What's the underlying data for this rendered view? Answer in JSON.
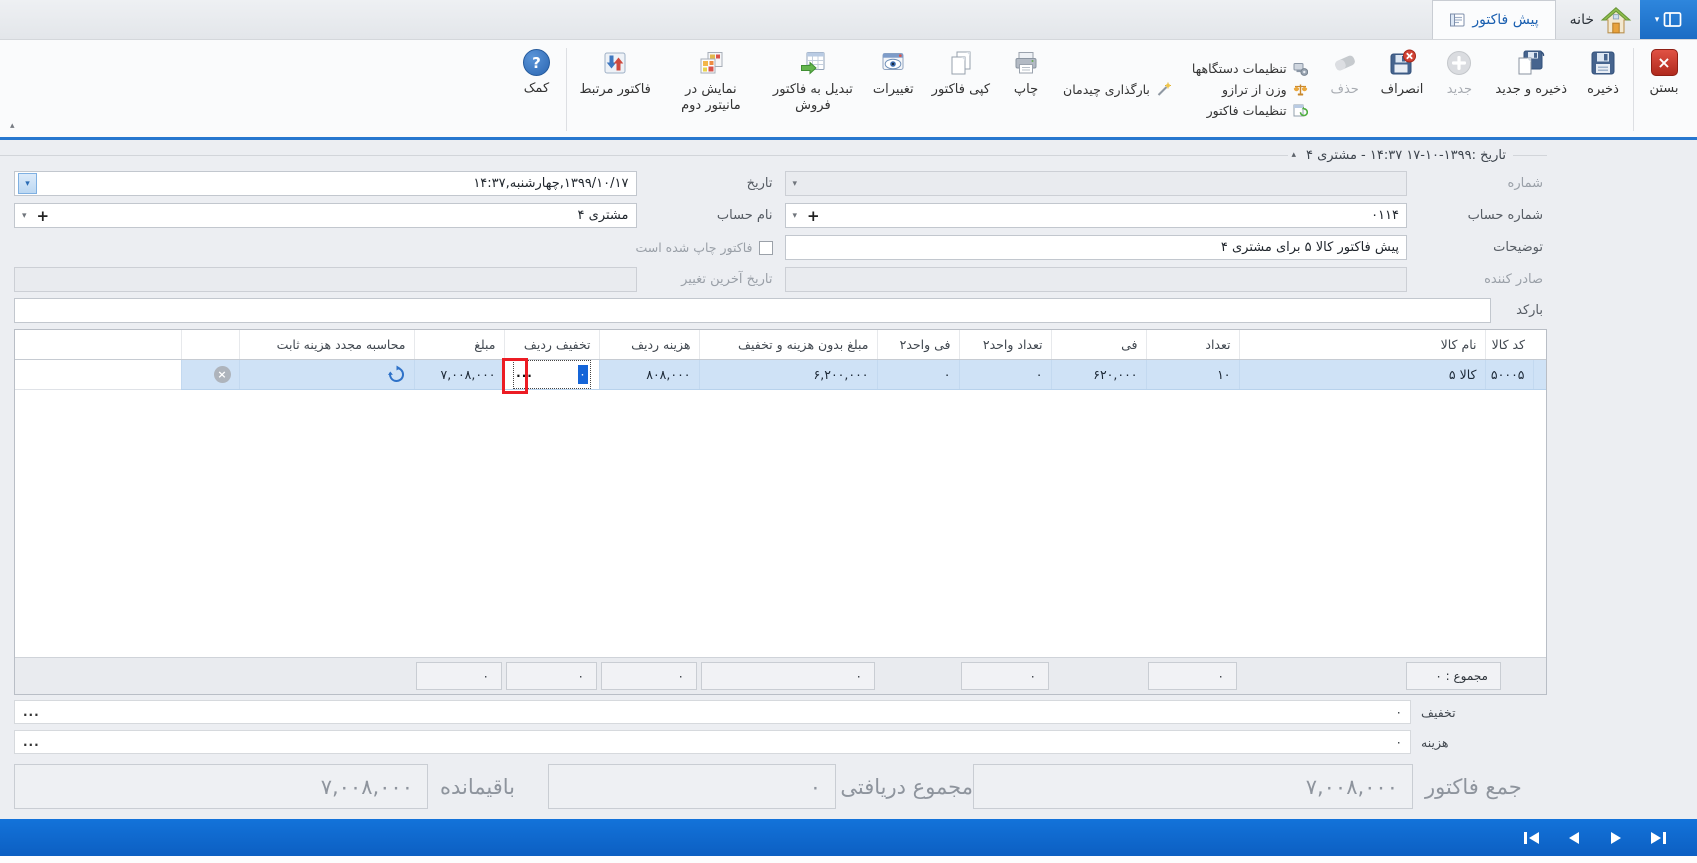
{
  "tabs": {
    "home_label": "خانه",
    "active_label": "پیش فاکتور"
  },
  "toolbar": {
    "close": "بستن",
    "save": "ذخیره",
    "save_and_new": "ذخیره و جدید",
    "new": "جدید",
    "cancel": "انصراف",
    "delete": "حذف",
    "device_settings": "تنظیمات دستگاهها",
    "weight_from_scale": "وزن از ترازو",
    "invoice_settings": "تنظیمات فاکتور",
    "load_layout": "بارگذاری چیدمان",
    "print": "چاپ",
    "copy_invoice": "کپی فاکتور",
    "changes": "تغییرات",
    "convert_to_sales_invoice": "تبدیل به فاکتور فروش",
    "show_on_second_monitor": "نمایش در مانیتور دوم",
    "related_invoice": "فاکتور مرتبط",
    "help": "کمک"
  },
  "group_header": {
    "title": "تاریخ :۱۳۹۹-۱۰-۱۷  ۱۴:۳۷ - مشتری ۴"
  },
  "form": {
    "number_label": "شماره",
    "number_value": "",
    "date_label": "تاریخ",
    "date_value": "۱۳۹۹/۱۰/۱۷,چهارشنبه,۱۴:۳۷",
    "account_number_label": "شماره حساب",
    "account_number_value": "۰۱۱۴",
    "account_name_label": "نام حساب",
    "account_name_value": "مشتری ۴",
    "description_label": "توضیحات",
    "description_value": "پیش فاکتور کالا ۵ برای مشتری ۴",
    "printed_checkbox_label": "فاکتور چاپ شده است",
    "issuer_label": "صادر کننده",
    "issuer_value": "",
    "last_change_label": "تاریخ آخرین تغییر",
    "last_change_value": "",
    "barcode_label": "بارکد",
    "barcode_value": ""
  },
  "grid": {
    "columns": [
      "کد کالا",
      "نام کالا",
      "تعداد",
      "فی",
      "تعداد واحد۲",
      "فی واحد۲",
      "مبلغ بدون هزینه و تخفیف",
      "هزینه ردیف",
      "تخفیف ردیف",
      "مبلغ",
      "محاسبه مجدد هزینه ثابت"
    ],
    "row": {
      "item_code": "۵۰۰۰۵",
      "item_name": "کالا ۵",
      "quantity": "۱۰",
      "unit_price": "۶۲۰,۰۰۰",
      "quantity2": "۰",
      "unit2_price": "۰",
      "amount_before_cost_discount": "۶,۲۰۰,۰۰۰",
      "row_cost": "۸۰۸,۰۰۰",
      "row_discount_editor_value": "۰",
      "amount": "۷,۰۰۸,۰۰۰"
    },
    "summary": {
      "total_label": "مجموع : ۰",
      "quantity": "۰",
      "quantity2": "۰",
      "amount_before_cost_discount": "۰",
      "row_cost": "۰",
      "row_discount": "۰",
      "amount": "۰"
    }
  },
  "footer": {
    "discount_label": "تخفیف",
    "discount_value": "۰",
    "cost_label": "هزینه",
    "cost_value": "۰",
    "invoice_total_label": "جمع فاکتور",
    "invoice_total_value": "۷,۰۰۸,۰۰۰",
    "received_total_label": "مجموع دریافتی",
    "received_total_value": "۰",
    "remaining_label": "باقیمانده",
    "remaining_value": "۷,۰۰۸,۰۰۰"
  },
  "icons": {
    "dropdown": "▾",
    "plus": "+",
    "ellipsis": "...",
    "collapse": "▴",
    "help_mark": "?",
    "close_x": "×"
  },
  "colors": {
    "accent_blue": "#1d74d2",
    "tab_text": "#1a5fb0",
    "selected_row": "#cfe2f6",
    "annotation_red": "#ec1c24",
    "bottom_bar": "#0d68cf"
  }
}
